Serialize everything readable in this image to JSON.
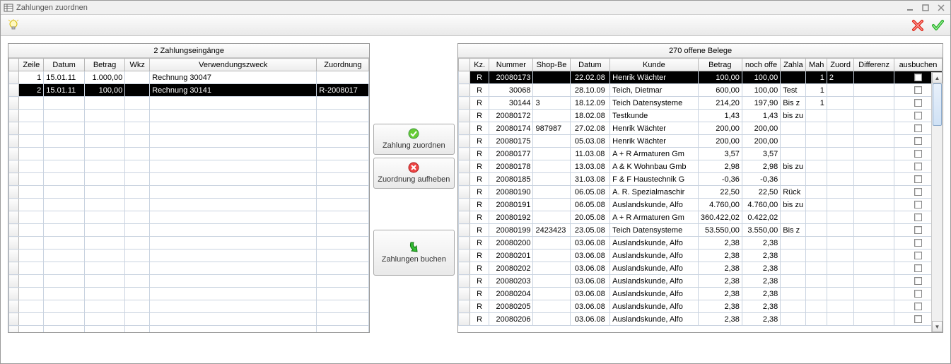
{
  "window": {
    "title": "Zahlungen zuordnen"
  },
  "left_panel": {
    "title": "2  Zahlungseingänge",
    "columns": [
      "Zeile",
      "Datum",
      "Betrag",
      "Wkz",
      "Verwendungszweck",
      "Zuordnung"
    ],
    "rows": [
      {
        "zeile": "1",
        "datum": "15.01.11",
        "betrag": "1.000,00",
        "wkz": "",
        "vz": "Rechnung 30047",
        "zuord": ""
      },
      {
        "zeile": "2",
        "datum": "15.01.11",
        "betrag": "100,00",
        "wkz": "",
        "vz": "Rechnung 30141",
        "zuord": "R-2008017"
      }
    ],
    "selected_index": 1
  },
  "mid": {
    "assign": "Zahlung zuordnen",
    "unassign": "Zuordnung aufheben",
    "book": "Zahlungen buchen"
  },
  "right_panel": {
    "title": "270  offene Belege",
    "columns": [
      "Kz.",
      "Nummer",
      "Shop-Be",
      "Datum",
      "Kunde",
      "Betrag",
      "noch offe",
      "Zahla",
      "Mah",
      "Zuord",
      "Differenz",
      "ausbuchen"
    ],
    "rows": [
      {
        "kz": "R",
        "nr": "20080173",
        "shop": "",
        "datum": "22.02.08",
        "kunde": "Henrik Wächter",
        "betrag": "100,00",
        "offen": "100,00",
        "zahl": "",
        "mah": "1",
        "zuord": "2",
        "diff": "",
        "aus": false
      },
      {
        "kz": "R",
        "nr": "30068",
        "shop": "",
        "datum": "28.10.09",
        "kunde": "Teich, Dietmar",
        "betrag": "600,00",
        "offen": "100,00",
        "zahl": "Test",
        "mah": "1",
        "zuord": "",
        "diff": "",
        "aus": false
      },
      {
        "kz": "R",
        "nr": "30144",
        "shop": "3",
        "datum": "18.12.09",
        "kunde": "Teich Datensysteme",
        "betrag": "214,20",
        "offen": "197,90",
        "zahl": "Bis z",
        "mah": "1",
        "zuord": "",
        "diff": "",
        "aus": false
      },
      {
        "kz": "R",
        "nr": "20080172",
        "shop": "",
        "datum": "18.02.08",
        "kunde": "Testkunde",
        "betrag": "1,43",
        "offen": "1,43",
        "zahl": "bis zu",
        "mah": "",
        "zuord": "",
        "diff": "",
        "aus": false
      },
      {
        "kz": "R",
        "nr": "20080174",
        "shop": "987987",
        "datum": "27.02.08",
        "kunde": "Henrik Wächter",
        "betrag": "200,00",
        "offen": "200,00",
        "zahl": "",
        "mah": "",
        "zuord": "",
        "diff": "",
        "aus": false
      },
      {
        "kz": "R",
        "nr": "20080175",
        "shop": "",
        "datum": "05.03.08",
        "kunde": "Henrik Wächter",
        "betrag": "200,00",
        "offen": "200,00",
        "zahl": "",
        "mah": "",
        "zuord": "",
        "diff": "",
        "aus": false
      },
      {
        "kz": "R",
        "nr": "20080177",
        "shop": "",
        "datum": "11.03.08",
        "kunde": "A + R Armaturen Gm",
        "betrag": "3,57",
        "offen": "3,57",
        "zahl": "",
        "mah": "",
        "zuord": "",
        "diff": "",
        "aus": false
      },
      {
        "kz": "R",
        "nr": "20080178",
        "shop": "",
        "datum": "13.03.08",
        "kunde": "A & K Wohnbau Gmb",
        "betrag": "2,98",
        "offen": "2,98",
        "zahl": "bis zu",
        "mah": "",
        "zuord": "",
        "diff": "",
        "aus": false
      },
      {
        "kz": "R",
        "nr": "20080185",
        "shop": "",
        "datum": "31.03.08",
        "kunde": "F & F Haustechnik G",
        "betrag": "-0,36",
        "offen": "-0,36",
        "zahl": "",
        "mah": "",
        "zuord": "",
        "diff": "",
        "aus": false
      },
      {
        "kz": "R",
        "nr": "20080190",
        "shop": "",
        "datum": "06.05.08",
        "kunde": "A. R. Spezialmaschir",
        "betrag": "22,50",
        "offen": "22,50",
        "zahl": "Rück",
        "mah": "",
        "zuord": "",
        "diff": "",
        "aus": false
      },
      {
        "kz": "R",
        "nr": "20080191",
        "shop": "",
        "datum": "06.05.08",
        "kunde": "Auslandskunde, Alfo",
        "betrag": "4.760,00",
        "offen": "4.760,00",
        "zahl": "bis zu",
        "mah": "",
        "zuord": "",
        "diff": "",
        "aus": false
      },
      {
        "kz": "R",
        "nr": "20080192",
        "shop": "",
        "datum": "20.05.08",
        "kunde": "A + R Armaturen Gm",
        "betrag": "360.422,02",
        "offen": "0.422,02",
        "zahl": "",
        "mah": "",
        "zuord": "",
        "diff": "",
        "aus": false
      },
      {
        "kz": "R",
        "nr": "20080199",
        "shop": "2423423",
        "datum": "23.05.08",
        "kunde": "Teich Datensysteme",
        "betrag": "53.550,00",
        "offen": "3.550,00",
        "zahl": "Bis z",
        "mah": "",
        "zuord": "",
        "diff": "",
        "aus": false
      },
      {
        "kz": "R",
        "nr": "20080200",
        "shop": "",
        "datum": "03.06.08",
        "kunde": "Auslandskunde, Alfo",
        "betrag": "2,38",
        "offen": "2,38",
        "zahl": "",
        "mah": "",
        "zuord": "",
        "diff": "",
        "aus": false
      },
      {
        "kz": "R",
        "nr": "20080201",
        "shop": "",
        "datum": "03.06.08",
        "kunde": "Auslandskunde, Alfo",
        "betrag": "2,38",
        "offen": "2,38",
        "zahl": "",
        "mah": "",
        "zuord": "",
        "diff": "",
        "aus": false
      },
      {
        "kz": "R",
        "nr": "20080202",
        "shop": "",
        "datum": "03.06.08",
        "kunde": "Auslandskunde, Alfo",
        "betrag": "2,38",
        "offen": "2,38",
        "zahl": "",
        "mah": "",
        "zuord": "",
        "diff": "",
        "aus": false
      },
      {
        "kz": "R",
        "nr": "20080203",
        "shop": "",
        "datum": "03.06.08",
        "kunde": "Auslandskunde, Alfo",
        "betrag": "2,38",
        "offen": "2,38",
        "zahl": "",
        "mah": "",
        "zuord": "",
        "diff": "",
        "aus": false
      },
      {
        "kz": "R",
        "nr": "20080204",
        "shop": "",
        "datum": "03.06.08",
        "kunde": "Auslandskunde, Alfo",
        "betrag": "2,38",
        "offen": "2,38",
        "zahl": "",
        "mah": "",
        "zuord": "",
        "diff": "",
        "aus": false
      },
      {
        "kz": "R",
        "nr": "20080205",
        "shop": "",
        "datum": "03.06.08",
        "kunde": "Auslandskunde, Alfo",
        "betrag": "2,38",
        "offen": "2,38",
        "zahl": "",
        "mah": "",
        "zuord": "",
        "diff": "",
        "aus": false
      },
      {
        "kz": "R",
        "nr": "20080206",
        "shop": "",
        "datum": "03.06.08",
        "kunde": "Auslandskunde, Alfo",
        "betrag": "2,38",
        "offen": "2,38",
        "zahl": "",
        "mah": "",
        "zuord": "",
        "diff": "",
        "aus": false
      }
    ],
    "selected_index": 0
  }
}
